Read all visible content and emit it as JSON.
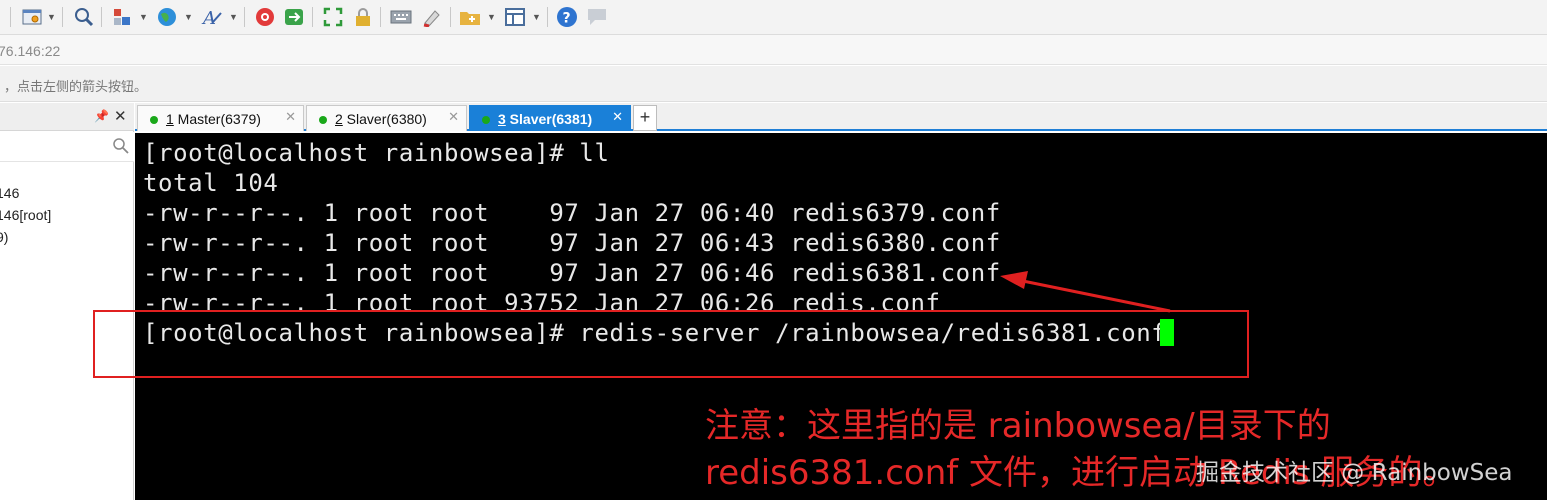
{
  "toolbar": {
    "icons": [
      "terminal-settings-icon",
      "find-icon",
      "session-manager-icon",
      "globe-icon",
      "font-icon",
      "redhat-icon",
      "transfer-icon",
      "fullscreen-icon",
      "lock-icon",
      "keyboard-icon",
      "highlight-icon",
      "new-folder-icon",
      "layout-icon",
      "help-icon",
      "chat-icon"
    ]
  },
  "address": {
    "text": "76.146:22"
  },
  "hint": {
    "text": "，点击左侧的箭头按钮。"
  },
  "left_panel": {
    "items": [
      "146",
      "146[root]",
      "9)"
    ]
  },
  "tabs": [
    {
      "number": "1",
      "label": " Master(6379)",
      "active": false
    },
    {
      "number": "2",
      "label": " Slaver(6380)",
      "active": false
    },
    {
      "number": "3",
      "label": " Slaver(6381)",
      "active": true
    }
  ],
  "tab_add_label": "+",
  "terminal": {
    "lines": [
      "[root@localhost rainbowsea]# ll",
      "total 104",
      "-rw-r--r--. 1 root root    97 Jan 27 06:40 redis6379.conf",
      "-rw-r--r--. 1 root root    97 Jan 27 06:43 redis6380.conf",
      "-rw-r--r--. 1 root root    97 Jan 27 06:46 redis6381.conf",
      "-rw-r--r--. 1 root root 93752 Jan 27 06:26 redis.conf",
      "[root@localhost rainbowsea]# redis-server /rainbowsea/redis6381.conf"
    ]
  },
  "annotation": {
    "line1": "注意：这里指的是 rainbowsea/目录下的",
    "line2": "redis6381.conf 文件，进行启动 Redis 服务的。"
  },
  "watermark": "掘金技术社区 @ RainbowSea",
  "colors": {
    "accent": "#1a80d8",
    "annotation": "#e52828",
    "cursor": "#00ff00",
    "terminal_bg": "#000000"
  }
}
